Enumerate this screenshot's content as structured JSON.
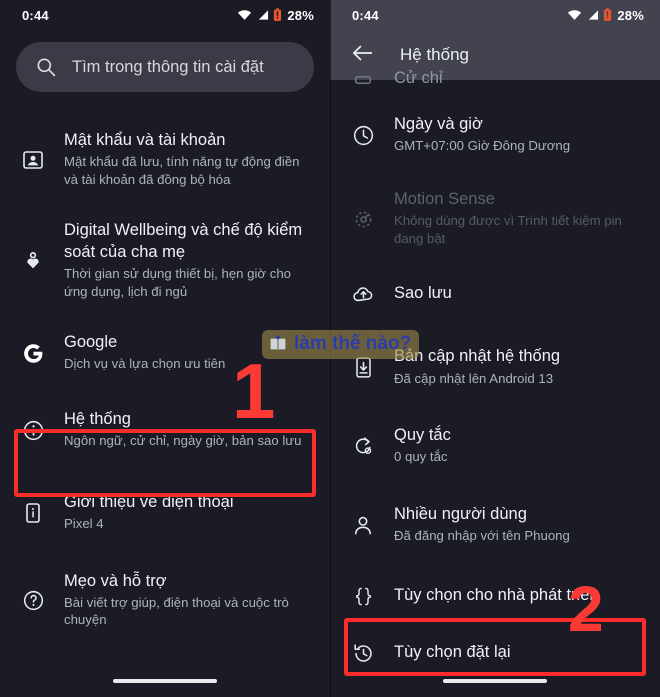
{
  "status_bar": {
    "time": "0:44",
    "battery_percent": "28%",
    "icons": [
      "wifi-icon",
      "signal-icon",
      "battery-low-icon"
    ]
  },
  "colors": {
    "accent_red": "#fb2c2c",
    "background": "#1b1b26",
    "appbar": "#43434f",
    "search_field": "#3b3b47",
    "watermark_text": "#2b3ea8",
    "watermark_bg": "#9c8848"
  },
  "left_panel": {
    "search": {
      "placeholder": "Tìm trong thông tin cài đặt",
      "icon": "search-icon"
    },
    "items": [
      {
        "icon": "account-box-icon",
        "title": "Mật khẩu và tài khoản",
        "subtitle": "Mật khẩu đã lưu, tính năng tự động điền và tài khoản đã đồng bộ hóa",
        "disabled": false
      },
      {
        "icon": "wellbeing-heart-icon",
        "title": "Digital Wellbeing và chế độ kiểm soát của cha mẹ",
        "subtitle": "Thời gian sử dụng thiết bị, hẹn giờ cho ứng dụng, lịch đi ngủ",
        "disabled": false
      },
      {
        "icon": "google-g-icon",
        "title": "Google",
        "subtitle": "Dịch vụ và lựa chọn ưu tiên",
        "disabled": false
      },
      {
        "icon": "info-circle-icon",
        "title": "Hệ thống",
        "subtitle": "Ngôn ngữ, cử chỉ, ngày giờ, bản sao lưu",
        "disabled": false,
        "highlighted": true
      },
      {
        "icon": "phone-info-icon",
        "title": "Giới thiệu về điện thoại",
        "subtitle": "Pixel 4",
        "disabled": false
      },
      {
        "icon": "help-circle-icon",
        "title": "Mẹo và hỗ trợ",
        "subtitle": "Bài viết trợ giúp, điện thoại và cuộc trò chuyện",
        "disabled": false
      }
    ]
  },
  "right_panel": {
    "appbar": {
      "back_icon": "back-arrow-icon",
      "title": "Hệ thống"
    },
    "items": [
      {
        "icon": "gesture-icon",
        "title": "Cử chỉ",
        "subtitle": "",
        "clipped": true,
        "disabled": false
      },
      {
        "icon": "clock-icon",
        "title": "Ngày và giờ",
        "subtitle": "GMT+07:00 Giờ Đông Dương",
        "disabled": false
      },
      {
        "icon": "motion-sense-icon",
        "title": "Motion Sense",
        "subtitle": "Không dùng được vì Trình tiết kiệm pin đang bật",
        "disabled": true
      },
      {
        "icon": "cloud-upload-icon",
        "title": "Sao lưu",
        "subtitle": "",
        "disabled": false
      },
      {
        "icon": "system-update-icon",
        "title": "Bản cập nhật hệ thống",
        "subtitle": "Đã cập nhật lên Android 13",
        "disabled": false
      },
      {
        "icon": "rules-icon",
        "title": "Quy tắc",
        "subtitle": "0 quy tắc",
        "disabled": false
      },
      {
        "icon": "person-icon",
        "title": "Nhiều người dùng",
        "subtitle": "Đã đăng nhập với tên Phuong",
        "disabled": false
      },
      {
        "icon": "braces-icon",
        "title": "Tùy chọn cho nhà phát triển",
        "subtitle": "",
        "disabled": false
      },
      {
        "icon": "history-restore-icon",
        "title": "Tùy chọn đặt lại",
        "subtitle": "",
        "disabled": false,
        "highlighted": true
      }
    ]
  },
  "annotations": {
    "step_one": "1",
    "step_two": "2",
    "watermark_text": "làm thế nào?"
  }
}
